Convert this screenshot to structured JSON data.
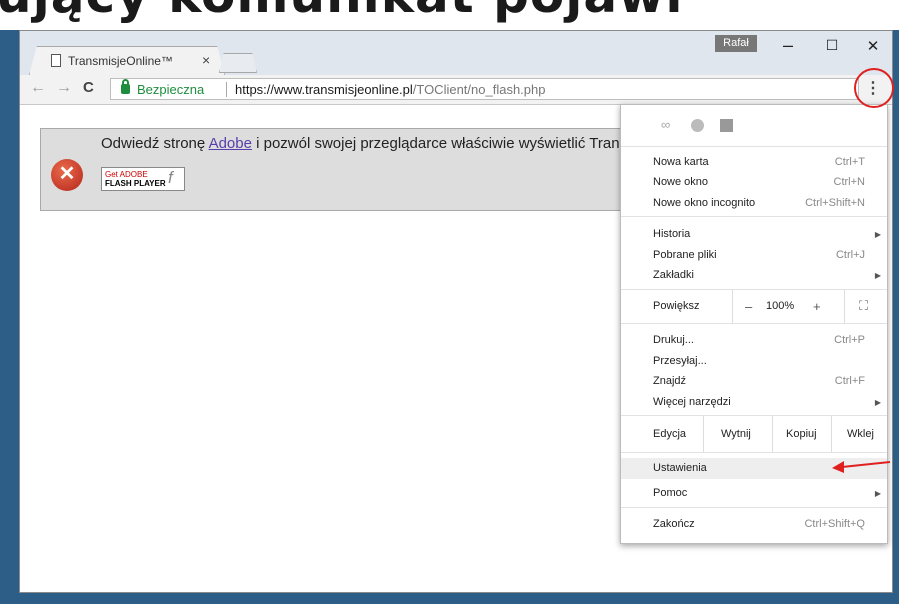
{
  "banner_text": "ujący komunikat pojawi",
  "browser": {
    "tab_title": "TransmisjeOnline™",
    "tab_close": "×",
    "user_badge": "Rafał",
    "window_controls": {
      "minimize": "–",
      "maximize": "☐",
      "close": "✕"
    }
  },
  "toolbar": {
    "back": "←",
    "forward": "→",
    "reload": "C",
    "secure_label": "Bezpieczna",
    "url_host": "https://www.transmisjeonline.pl",
    "url_path": "/TOClient/no_flash.php",
    "star": "☆",
    "menu": "⋮"
  },
  "page": {
    "msg_before": "Odwiedź stronę ",
    "msg_link": "Adobe",
    "msg_after": " i pozwól swojej przeglądarce właściwie wyświetlić Tran",
    "error_icon": "✕",
    "flash_get": "Get ADOBE",
    "flash_player": "FLASH PLAYER",
    "flash_f": "f"
  },
  "menu": {
    "new_tab": {
      "label": "Nowa karta",
      "shortcut": "Ctrl+T"
    },
    "new_window": {
      "label": "Nowe okno",
      "shortcut": "Ctrl+N"
    },
    "incognito": {
      "label": "Nowe okno incognito",
      "shortcut": "Ctrl+Shift+N"
    },
    "history": {
      "label": "Historia"
    },
    "downloads": {
      "label": "Pobrane pliki",
      "shortcut": "Ctrl+J"
    },
    "bookmarks": {
      "label": "Zakładki"
    },
    "zoom": {
      "label": "Powiększ",
      "minus": "–",
      "value": "100%",
      "plus": "+",
      "fullscreen": "⛶"
    },
    "print": {
      "label": "Drukuj...",
      "shortcut": "Ctrl+P"
    },
    "cast": {
      "label": "Przesyłaj..."
    },
    "find": {
      "label": "Znajdź",
      "shortcut": "Ctrl+F"
    },
    "more_tools": {
      "label": "Więcej narzędzi"
    },
    "edit": {
      "label": "Edycja",
      "cut": "Wytnij",
      "copy": "Kopiuj",
      "paste": "Wklej"
    },
    "settings": {
      "label": "Ustawienia"
    },
    "help": {
      "label": "Pomoc"
    },
    "exit": {
      "label": "Zakończ",
      "shortcut": "Ctrl+Shift+Q"
    },
    "submenu_arrow": "▶"
  },
  "colors": {
    "accent_red": "#e02020",
    "secure_green": "#1e8e3e",
    "link": "#5a3eaa"
  }
}
